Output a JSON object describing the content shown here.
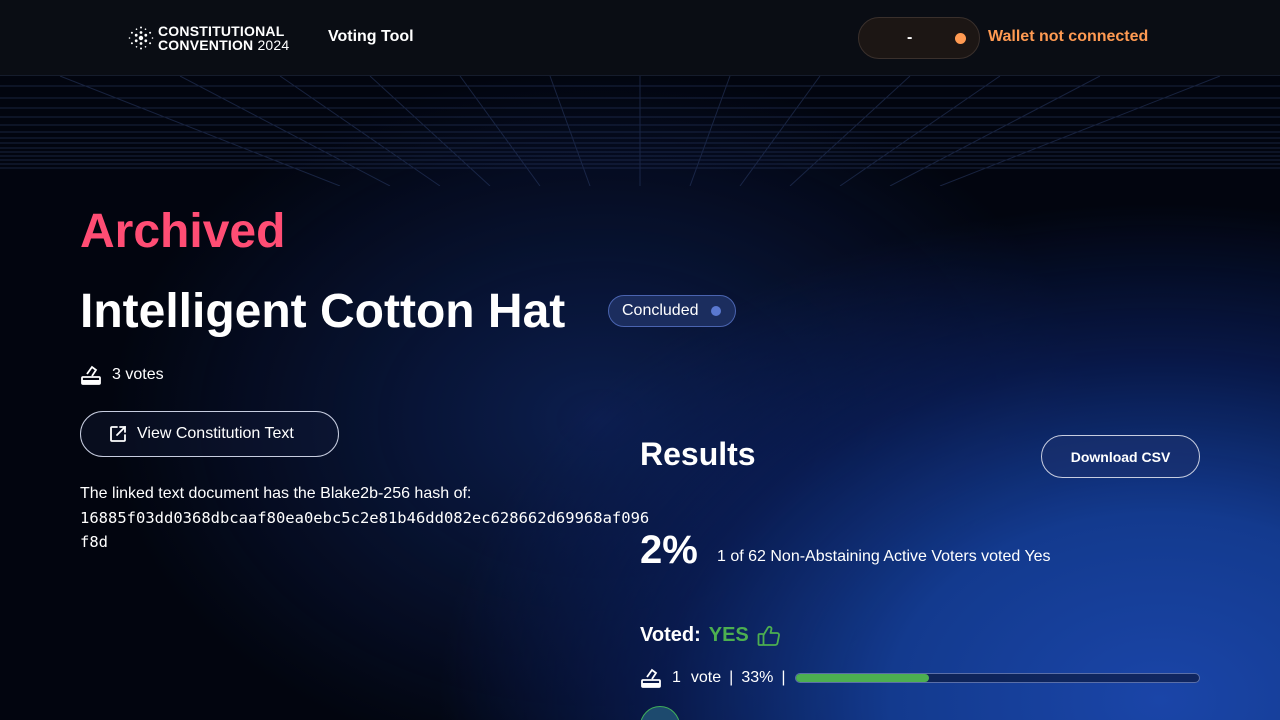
{
  "header": {
    "logo_line1": "CONSTITUTIONAL",
    "logo_line2": "CONVENTION",
    "logo_year": "2024",
    "nav_label": "Voting Tool",
    "wallet_value": "-",
    "wallet_status": "Wallet not connected",
    "wallet_dot_color": "#ff9a52"
  },
  "proposal": {
    "archived_label": "Archived",
    "title": "Intelligent Cotton Hat",
    "status_badge": "Concluded",
    "votes_count": "3 votes",
    "view_button_label": "View Constitution Text",
    "hash_intro": "The linked text document has the Blake2b-256 hash of:",
    "hash_value": "16885f03dd0368dbcaaf80ea0ebc5c2e81b46dd082ec628662d69968af096f8d"
  },
  "results": {
    "title": "Results",
    "download_label": "Download CSV",
    "percent": "2%",
    "summary": "1 of 62 Non-Abstaining Active Voters voted Yes",
    "voted_label": "Voted:",
    "voted_choice": "YES",
    "vote_count": "1",
    "vote_word": "vote",
    "vote_percent": "33%",
    "progress_fraction": 0.33,
    "yes_color": "#4caf50"
  },
  "icons": {
    "logo": "cardano-logo-icon",
    "ballot": "ballot-box-icon",
    "external": "external-link-icon",
    "thumbs_up": "thumbs-up-icon"
  }
}
